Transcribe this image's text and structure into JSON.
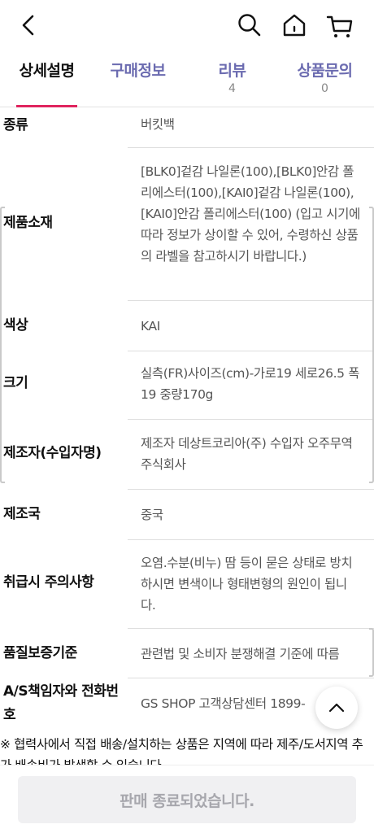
{
  "header": {
    "back_icon": "chevron-left-icon",
    "search_icon": "search-icon",
    "home_icon": "home-icon",
    "cart_icon": "cart-icon"
  },
  "tabs": [
    {
      "label": "상세설명",
      "count": ""
    },
    {
      "label": "구매정보",
      "count": ""
    },
    {
      "label": "리뷰",
      "count": "4"
    },
    {
      "label": "상품문의",
      "count": "0"
    }
  ],
  "active_tab": "상세설명",
  "specs": [
    {
      "key": "종류",
      "value": "버킷백"
    },
    {
      "key": "제품소재",
      "value": "[BLK0]겉감 나일론(100),[BLK0]안감 폴리에스터(100),[KAI0]겉감 나일론(100),[KAI0]안감 폴리에스터(100) (입고 시기에 따라 정보가 상이할 수 있어, 수령하신 상품의 라벨을 참고하시기 바랍니다.)"
    },
    {
      "key": "색상",
      "value": "KAI"
    },
    {
      "key": "크기",
      "value": "실측(FR)사이즈(cm)-가로19 세로26.5 폭19 중량170g"
    },
    {
      "key": "제조자(수입자명)",
      "value": "제조자 데상트코리아(주) 수입자 오주무역 주식회사"
    },
    {
      "key": "제조국",
      "value": "중국"
    },
    {
      "key": "취급시 주의사항",
      "value": "오염.수분(비누) 땀 등이 묻은 상태로 방치하시면 변색이나 형태변형의 원인이 됩니다."
    },
    {
      "key": "품질보증기준",
      "value": "관련법 및 소비자 분쟁해결 기준에 따름"
    },
    {
      "key": "A/S책임자와 전화번호",
      "value": "GS SHOP 고객상담센터 1899-"
    }
  ],
  "notice": "※ 협력사에서 직접 배송/설치하는 상품은 지역에 따라 제주/도서지역 추가 배송비가 발생할 수 있습니다.",
  "scroll_top_icon": "chevron-up-icon",
  "bottom_button": "판매 종료되었습니다.",
  "colors": {
    "accent": "#e0245e",
    "tab_inactive": "#6b6bb0",
    "disabled_bg": "#f0f0f2",
    "disabled_text": "#a7a7ad"
  }
}
